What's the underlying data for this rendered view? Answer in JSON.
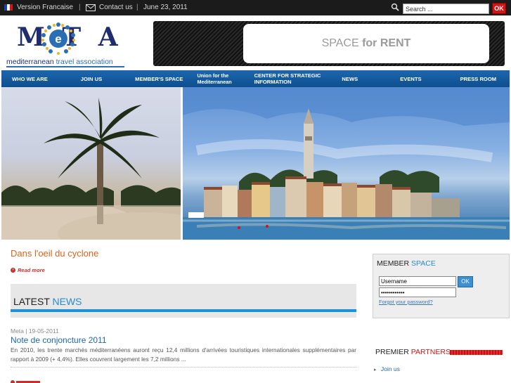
{
  "topbar": {
    "language": "Version Francaise",
    "separator": "|",
    "contact": "Contact us",
    "date": "June 23, 2011",
    "search_placeholder": "Search ...",
    "search_button": "OK"
  },
  "logo": {
    "letters": "M  T A",
    "tagline_1": "mediterranean ",
    "tagline_2": "travel association"
  },
  "banner": {
    "text_1": "SPACE ",
    "text_2": "for RENT"
  },
  "nav": {
    "items": [
      "WHO WE ARE",
      "JOIN US",
      "MEMBER'S SPACE",
      "Union for the Mediterranean",
      "CENTER FOR STRATEGIC INFORMATION",
      "NEWS",
      "EVENTS",
      "PRESS ROOM"
    ],
    "item_4_line1": "Union for the",
    "item_4_line2": "Mediterranean",
    "item_5_line1": "CENTER FOR STRATEGIC",
    "item_5_line2": "INFORMATION"
  },
  "lead": {
    "title": "Dans l'oeil du cyclone",
    "read_more": "Read more"
  },
  "latest": {
    "label_1": "LATEST ",
    "label_2": "NEWS"
  },
  "news": {
    "meta": "Meta | 19-05-2011",
    "title": "Note de conjoncture 2011",
    "body": "En 2010, les trente marchés méditerranéens auront reçu 12,4 millions d'arrivées touristiques internationales supplémentaires par rapport à 2009 (+ 4,4%). Elles couvrent largement les 7,2 millions ..."
  },
  "member": {
    "heading_1": "MEMBER ",
    "heading_2": "SPACE",
    "username": "Username",
    "password": "••••••••••••",
    "ok": "OK",
    "forgot": "Forgot your password?"
  },
  "partners": {
    "heading_1": "PREMIER ",
    "heading_2": "PARTNERS",
    "link": "Join us"
  },
  "colors": {
    "nav_blue": "#1d67ad",
    "accent_orange": "#d8641a",
    "accent_red": "#d01515",
    "bar_blue": "#1c93d8"
  }
}
